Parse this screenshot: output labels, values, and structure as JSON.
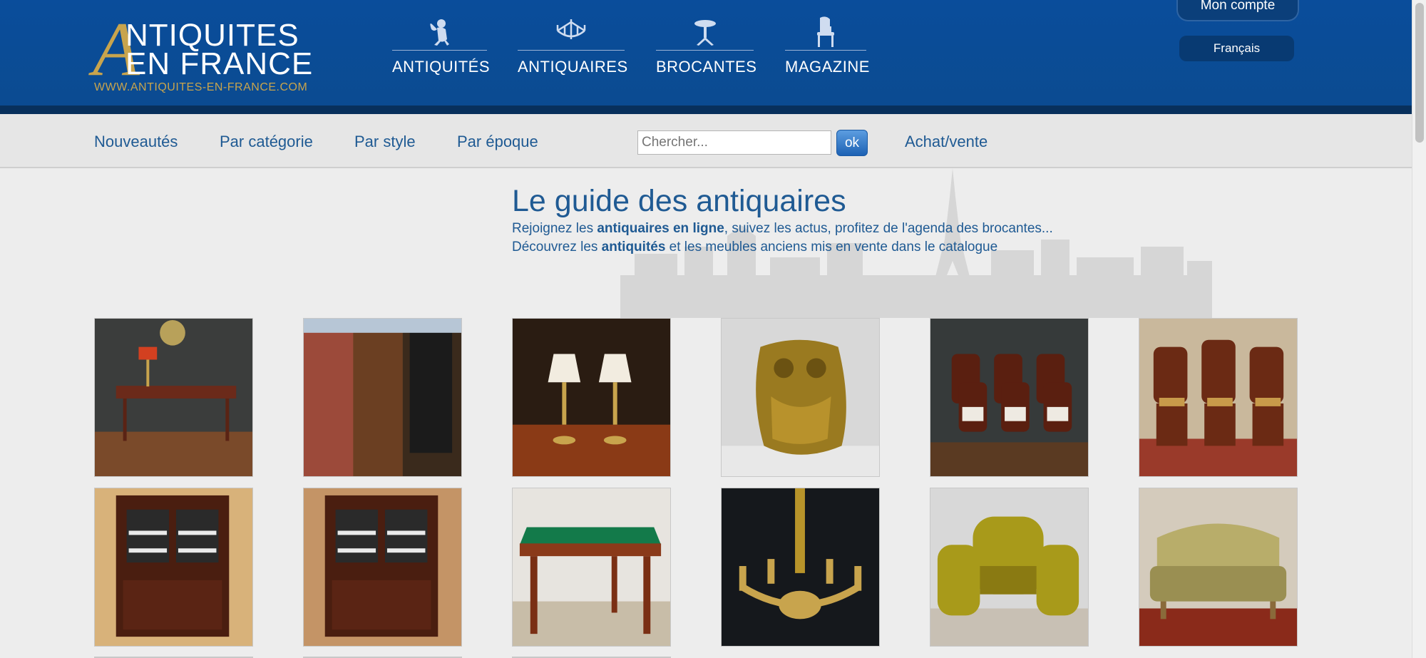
{
  "logo": {
    "letter_a": "A",
    "line1": "NTIQUITES",
    "line2": "EN FRANCE",
    "url": "WWW.ANTIQUITES-EN-FRANCE.COM"
  },
  "main_nav": [
    {
      "label": "ANTIQUITÉS",
      "icon": "cherub-icon"
    },
    {
      "label": "ANTIQUAIRES",
      "icon": "chandelier-icon"
    },
    {
      "label": "BROCANTES",
      "icon": "gueridon-table-icon"
    },
    {
      "label": "MAGAZINE",
      "icon": "chair-icon"
    }
  ],
  "account": {
    "label": "Mon compte"
  },
  "language": {
    "label": "Français"
  },
  "sub_nav": {
    "links": [
      "Nouveautés",
      "Par catégorie",
      "Par style",
      "Par époque"
    ],
    "buy_sell": "Achat/vente"
  },
  "search": {
    "placeholder": "Chercher...",
    "button_label": "ok"
  },
  "hero": {
    "title": "Le guide des antiquaires",
    "line1_a": "Rejoignez les ",
    "line1_b": "antiquaires en ligne",
    "line1_c": ", suivez les actus, profitez de l'agenda des brocantes...",
    "line2_a": "Découvrez les ",
    "line2_b": "antiquités",
    "line2_c": " et les meubles anciens mis en vente dans le catalogue"
  },
  "colors": {
    "header_blue": "#0b4b91",
    "gold": "#c8a44d",
    "link_blue": "#1f5a93"
  },
  "products": [
    {
      "name": "product-writing-desk"
    },
    {
      "name": "product-open-cabinet"
    },
    {
      "name": "product-pair-of-lamps"
    },
    {
      "name": "product-brass-owl"
    },
    {
      "name": "product-six-chairs"
    },
    {
      "name": "product-caned-chairs"
    },
    {
      "name": "product-glazed-buffet"
    },
    {
      "name": "product-glazed-buffet-2"
    },
    {
      "name": "product-card-table"
    },
    {
      "name": "product-gilt-chandelier"
    },
    {
      "name": "product-salon-suite"
    },
    {
      "name": "product-sofa"
    }
  ]
}
